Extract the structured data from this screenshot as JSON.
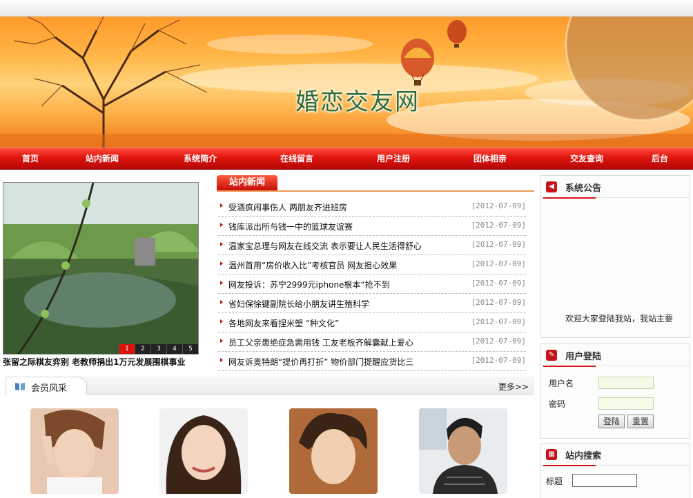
{
  "site": {
    "title": "婚恋交友网"
  },
  "nav": {
    "items": [
      "首页",
      "站内新闻",
      "系统简介",
      "在线留言",
      "用户注册",
      "团体相亲",
      "交友查询",
      "后台"
    ]
  },
  "slideshow": {
    "caption": "张留之际棋友弈别 老教师捐出1万元发展围棋事业",
    "pages": [
      "1",
      "2",
      "3",
      "4",
      "5"
    ],
    "active_page": "1"
  },
  "news": {
    "tab_label": "站内新闻",
    "items": [
      {
        "title": "受酒疯闹事伤人 两朋友齐进班房",
        "date": "[2012-07-09]"
      },
      {
        "title": "钱库派出所与钱一中的篮球友谊赛",
        "date": "[2012-07-09]"
      },
      {
        "title": "温家宝总理与网友在线交流 表示要让人民生活得舒心",
        "date": "[2012-07-09]"
      },
      {
        "title": "温州首用“房价收入比”考核官员 网友担心效果",
        "date": "[2012-07-09]"
      },
      {
        "title": "网友投诉：苏宁2999元iphone根本“抢不到",
        "date": "[2012-07-09]"
      },
      {
        "title": "省妇保徐键副院长给小朋友讲生殖科学",
        "date": "[2012-07-09]"
      },
      {
        "title": "各地网友来看捏米塑 “种文化”",
        "date": "[2012-07-09]"
      },
      {
        "title": "员工父亲患绝症急需用钱 工友老板齐解囊献上爱心",
        "date": "[2012-07-09]"
      },
      {
        "title": "网友诉奥特朗“提价再打折” 物价部门提醒应货比三",
        "date": "[2012-07-09]"
      }
    ]
  },
  "members": {
    "title": "会员风采",
    "more_label": "更多>>"
  },
  "notice": {
    "title": "系统公告",
    "text": "欢迎大家登陆我站，我站主要"
  },
  "login": {
    "title": "用户登陆",
    "username_label": "用户名",
    "password_label": "密码",
    "login_button": "登陆",
    "reset_button": "重置"
  },
  "search": {
    "title": "站内搜索",
    "label": "标题"
  },
  "colors": {
    "nav_red": "#d9120a",
    "accent_red": "#c4141a",
    "banner_orange": "#ffb444",
    "title_green": "#2f6b37"
  }
}
